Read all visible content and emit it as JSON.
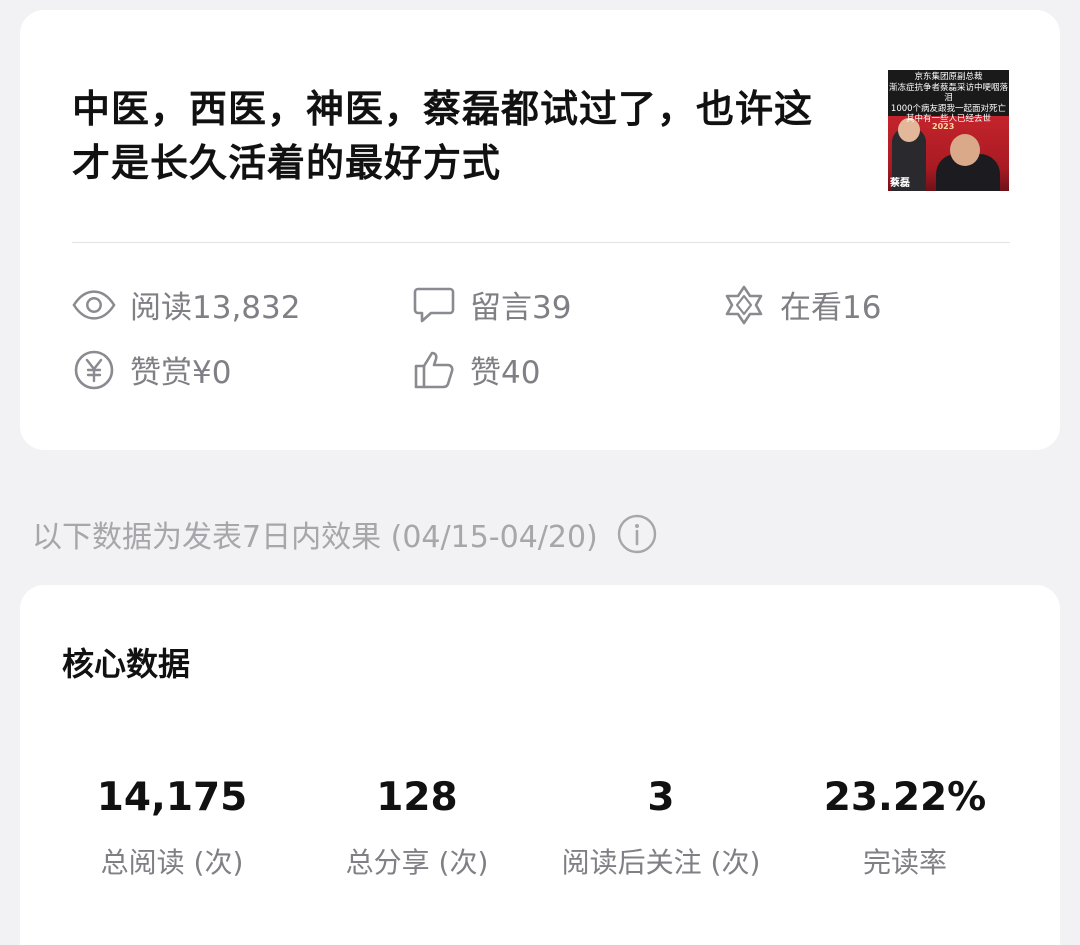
{
  "article": {
    "title": "中医，西医，神医，蔡磊都试过了，也许这才是长久活着的最好方式",
    "thumbnail": {
      "caption_lines": [
        "京东集团原副总裁",
        "渐冻症抗争者蔡磊采访中哽咽落泪",
        "1000个病友跟我一起面对死亡",
        "其中有一些人已经去世"
      ],
      "name_tag": "蔡磊",
      "year": "2023"
    },
    "stats": {
      "reads": "阅读13,832",
      "comments": "留言39",
      "watching": "在看16",
      "rewards": "赞赏¥0",
      "likes": "赞40"
    }
  },
  "note": {
    "text": "以下数据为发表7日内效果 (04/15-04/20)"
  },
  "core": {
    "title": "核心数据",
    "metrics": [
      {
        "value": "14,175",
        "label": "总阅读 (次)"
      },
      {
        "value": "128",
        "label": "总分享 (次)"
      },
      {
        "value": "3",
        "label": "阅读后关注 (次)"
      },
      {
        "value": "23.22%",
        "label": "完读率"
      }
    ]
  },
  "icons": {
    "reads": "eye-icon",
    "comments": "comment-bubble-icon",
    "watching": "watching-star-icon",
    "rewards": "yen-coin-icon",
    "likes": "thumbs-up-icon",
    "note_info": "info-icon"
  },
  "colors": {
    "background": "#f2f2f4",
    "card": "#ffffff",
    "text_primary": "#111111",
    "text_secondary": "#7f7f85",
    "text_hint": "#a6a6ab"
  }
}
